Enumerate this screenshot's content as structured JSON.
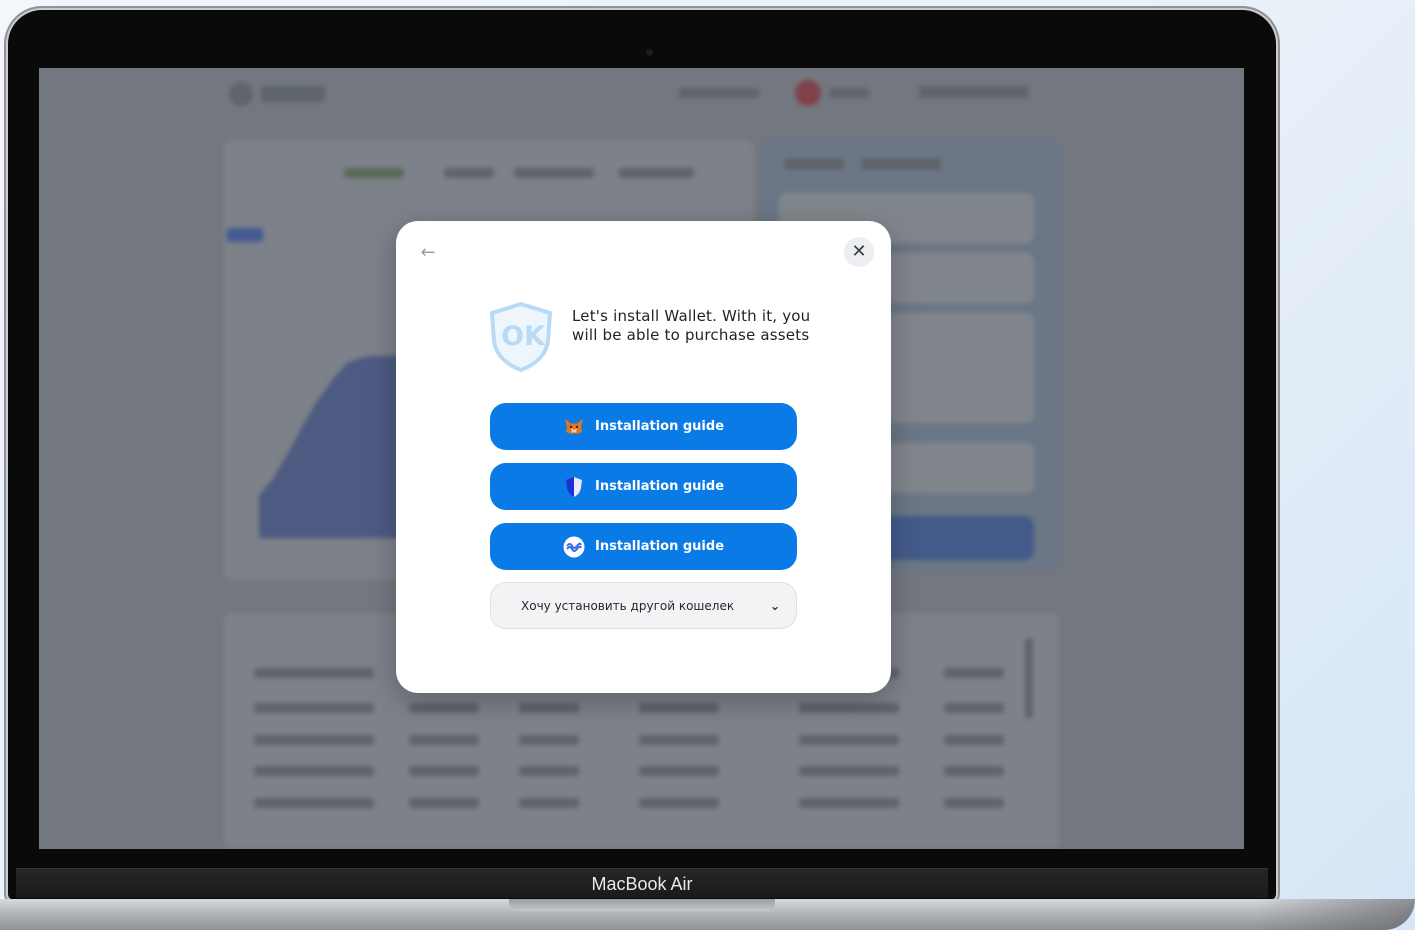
{
  "device": {
    "model_label": "MacBook Air"
  },
  "modal": {
    "intro_text": "Let's install Wallet. With it, you will be able to purchase assets",
    "logo_text": "OK",
    "buttons": [
      {
        "label": "Installation guide",
        "icon": "metamask-fox-icon"
      },
      {
        "label": "Installation guide",
        "icon": "blue-shield-wallet-icon"
      },
      {
        "label": "Installation guide",
        "icon": "wave-wallet-icon"
      }
    ],
    "other_wallet_select": {
      "selected": "Хочу установить другой кошелек",
      "icon": "chevron-down-icon"
    }
  },
  "colors": {
    "primary_button": "#0a7be6",
    "modal_background": "#ffffff",
    "screen_dim": "#8c9097"
  }
}
